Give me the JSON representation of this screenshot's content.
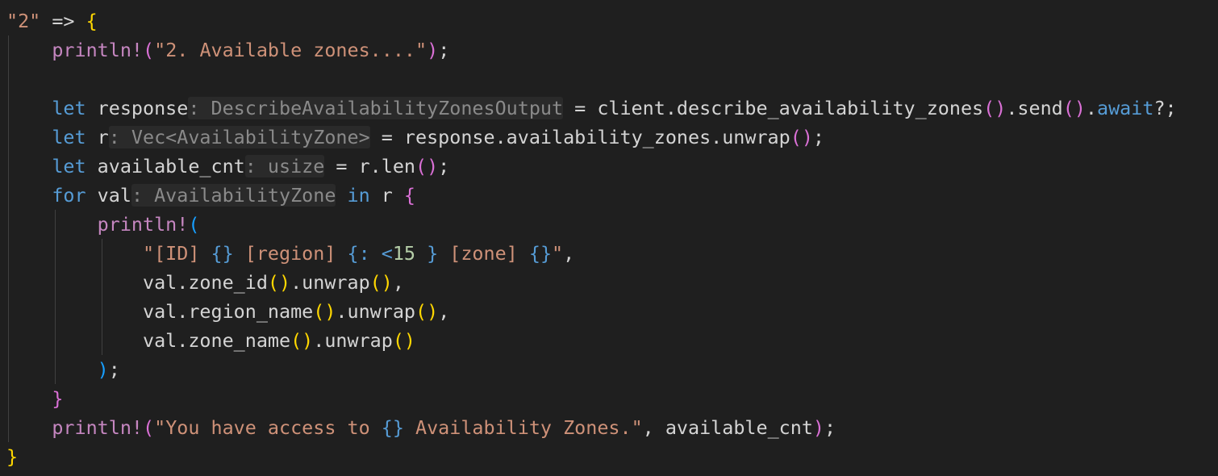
{
  "code": {
    "l1": {
      "str": "\"2\"",
      "op": " => ",
      "brace": "{"
    },
    "l2": {
      "macro": "println!",
      "open": "(",
      "str": "\"2. Available zones....\"",
      "close": ")",
      "semi": ";"
    },
    "l4": {
      "kw": "let",
      "name": " response",
      "hint": ": DescribeAvailabilityZonesOutput",
      "eq": " = ",
      "client": "client",
      "dot1": ".",
      "call": "describe_availability_zones",
      "p1": "()",
      "dot2": ".",
      "send": "send",
      "p2": "()",
      "dot3": ".",
      "await": "await",
      "tail": "?;"
    },
    "l5": {
      "kw": "let",
      "name": " r",
      "hint": ": Vec<AvailabilityZone>",
      "eq": " = ",
      "expr": "response.availability_zones.unwrap",
      "p1": "()",
      "semi": ";"
    },
    "l6": {
      "kw": "let",
      "name": " available_cnt",
      "hint": ": usize",
      "eq": " = ",
      "expr": "r.len",
      "p1": "()",
      "semi": ";"
    },
    "l7": {
      "kw": "for",
      "name": " val",
      "hint": ": AvailabilityZone",
      "in": " in",
      "rest": " r ",
      "brace": "{"
    },
    "l8": {
      "macro": "println!",
      "open": "("
    },
    "l9": {
      "s1": "\"[ID] ",
      "f1": "{}",
      "s2": " [region] ",
      "f2": "{:",
      "f2b": " <",
      "num": "15",
      "f2c": " }",
      "s3": " [zone] ",
      "f3": "{}",
      "s4": "\"",
      "comma": ","
    },
    "l10": {
      "expr": "val.zone_id",
      "p1": "()",
      "dot": ".",
      "unwrap": "unwrap",
      "p2": "()",
      "comma": ","
    },
    "l11": {
      "expr": "val.region_name",
      "p1": "()",
      "dot": ".",
      "unwrap": "unwrap",
      "p2": "()",
      "comma": ","
    },
    "l12": {
      "expr": "val.zone_name",
      "p1": "()",
      "dot": ".",
      "unwrap": "unwrap",
      "p2": "()"
    },
    "l13": {
      "close": ")",
      "semi": ";"
    },
    "l14": {
      "brace": "}"
    },
    "l15": {
      "macro": "println!",
      "open": "(",
      "s1": "\"You have access to ",
      "f1": "{}",
      "s2": " Availability Zones.\"",
      "rest": ", available_cnt",
      "close": ")",
      "semi": ";"
    },
    "l16": {
      "brace": "}"
    }
  }
}
